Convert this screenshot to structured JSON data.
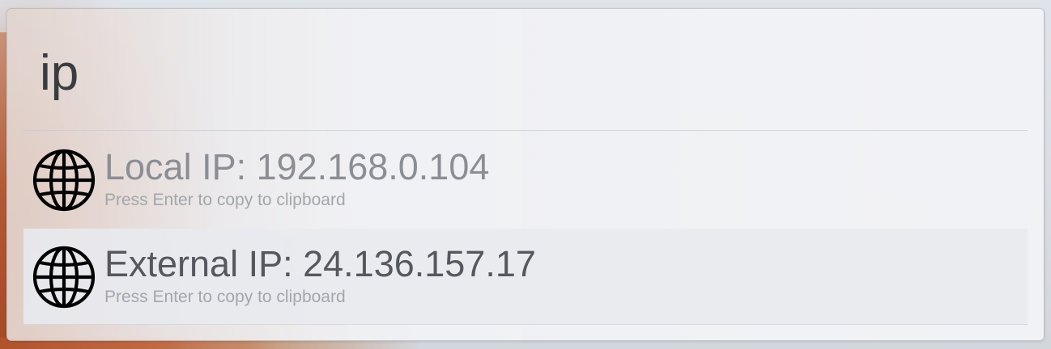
{
  "search": {
    "query": "ip"
  },
  "results": [
    {
      "icon": "globe-icon",
      "title": "Local IP: 192.168.0.104",
      "subtitle": "Press Enter to copy to clipboard"
    },
    {
      "icon": "globe-icon",
      "title": "External IP: 24.136.157.17",
      "subtitle": "Press Enter to copy to clipboard"
    }
  ],
  "colors": {
    "query_text": "#3a3c40",
    "result_title_dim": "#8b8e94",
    "result_title_active": "#55585e",
    "subtitle": "#a3a6ab",
    "selected_row_bg": "#e8eaee"
  }
}
